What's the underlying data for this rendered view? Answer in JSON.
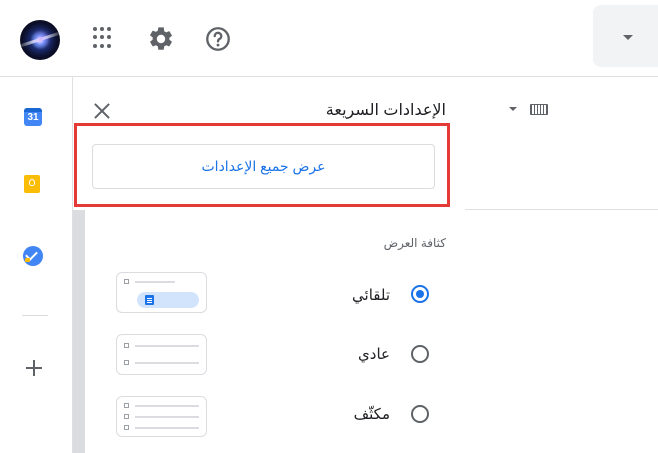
{
  "header": {
    "account_avatar": "avatar",
    "apps_icon": "apps-grid-icon",
    "settings_icon": "gear-icon",
    "help_icon": "help-icon",
    "dropdown_icon": "caret-down-icon"
  },
  "rail": {
    "calendar": {
      "icon": "calendar-icon",
      "label": "31",
      "color": "#4285f4"
    },
    "keep": {
      "icon": "keep-bulb-icon",
      "color": "#fbbc04"
    },
    "tasks": {
      "icon": "tasks-check-icon",
      "color": "#4285f4"
    },
    "add_icon": "plus-icon"
  },
  "quick_settings": {
    "title": "الإعدادات السريعة",
    "close_icon": "close-icon",
    "see_all_label": "عرض جميع الإعدادات",
    "highlight_color": "#e53935",
    "density": {
      "title": "كثافة العرض",
      "options": [
        {
          "label": "تلقائي",
          "selected": true
        },
        {
          "label": "عادي",
          "selected": false
        },
        {
          "label": "مكثّف",
          "selected": false
        }
      ]
    }
  },
  "background": {
    "keyboard_icon": "keyboard-icon",
    "keyboard_caret_icon": "caret-down-icon"
  },
  "colors": {
    "accent": "#1a73e8",
    "text": "#202124",
    "muted": "#5f6368"
  }
}
